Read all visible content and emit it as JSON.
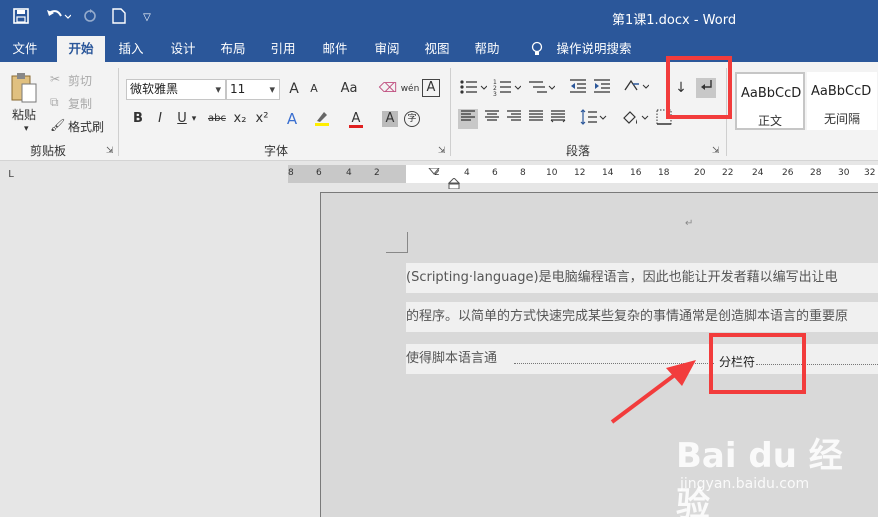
{
  "titlebar": {
    "title": "第1课1.docx  -  Word",
    "save_icon": "save-icon",
    "undo_icon": "undo-icon",
    "redo_icon": "redo-icon",
    "new_icon": "new-doc-icon",
    "customize_icon": "customize-qat-icon"
  },
  "tabs": [
    "文件",
    "开始",
    "插入",
    "设计",
    "布局",
    "引用",
    "邮件",
    "审阅",
    "视图",
    "帮助"
  ],
  "tell_me": "操作说明搜索",
  "clipboard": {
    "paste": "粘贴",
    "cut": "剪切",
    "copy": "复制",
    "format_painter": "格式刷",
    "label": "剪贴板"
  },
  "font": {
    "name": "微软雅黑",
    "size": "11",
    "label": "字体",
    "bold": "B",
    "italic": "I",
    "underline": "U",
    "strike": "abc",
    "subscript": "x₂",
    "superscript": "x²",
    "grow": "A",
    "shrink": "A",
    "case": "Aa",
    "phonetic": "wén",
    "border_char": "A",
    "font_color": "A",
    "shading_char": "A",
    "enclose": "字"
  },
  "paragraph": {
    "label": "段落"
  },
  "styles": [
    {
      "sample": "AaBbCcD",
      "name": "正文"
    },
    {
      "sample": "AaBbCcD",
      "name": "无间隔"
    }
  ],
  "ruler": {
    "corner": "L",
    "ticks_left": [
      "8",
      "6",
      "4",
      "2"
    ],
    "ticks_right": [
      "2",
      "4",
      "6",
      "8",
      "10",
      "12",
      "14",
      "16",
      "18",
      "20",
      "22",
      "24",
      "26",
      "28",
      "30",
      "32"
    ]
  },
  "document": {
    "line1": "(Scripting·language)是电脑编程语言，因此也能让开发者藉以编写出让电",
    "line2": "的程序。以简单的方式快速完成某些复杂的事情通常是创造脚本语言的重要原",
    "line3": "使得脚本语言通",
    "column_break": "分栏符",
    "para_mark": "↵"
  },
  "watermark": {
    "logo": "Bai du 经验",
    "site": "jingyan.baidu.com"
  },
  "colors": {
    "word_blue": "#2b579a",
    "annotation_red": "#f23c3c"
  }
}
